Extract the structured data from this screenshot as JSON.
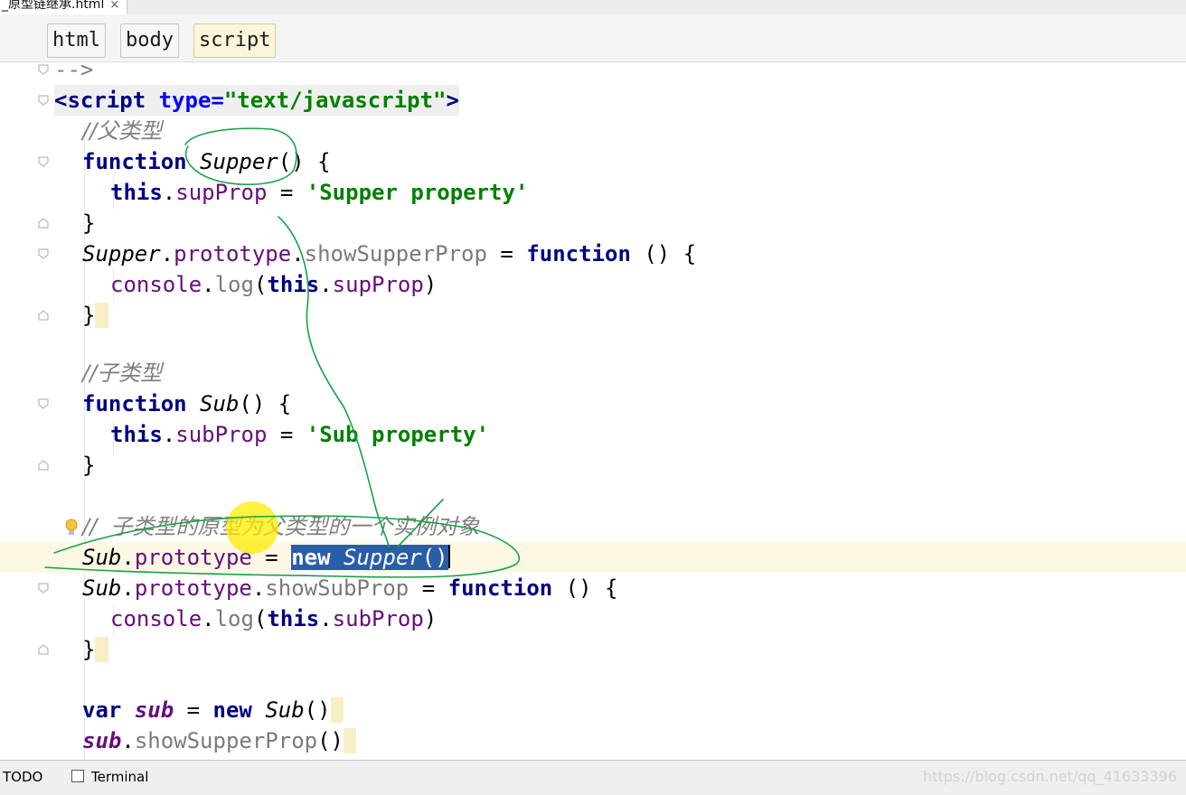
{
  "tab": {
    "title": "_原型链继承.html",
    "close": "×"
  },
  "breadcrumb": [
    "html",
    "body",
    "script"
  ],
  "code": {
    "l0": "-->",
    "l1_tag_open": "<script ",
    "l1_attr": "type=",
    "l1_val": "\"text/javascript\"",
    "l1_close": ">",
    "l2": "//父类型",
    "l3_kw": "function",
    "l3_name": "Supper",
    "l3_rest": "() {",
    "l4_this": "this",
    "l4_dot": ".",
    "l4_prop": "supProp",
    "l4_eq": " = ",
    "l4_str": "'Supper property'",
    "l5": "}",
    "l6_obj": "Supper",
    "l6_dot": ".",
    "l6_proto": "prototype",
    "l6_dot2": ".",
    "l6_method": "showSupperProp",
    "l6_eq": " = ",
    "l6_kw": "function",
    "l6_rest": " () {",
    "l7_console": "console",
    "l7_dot": ".",
    "l7_log": "log",
    "l7_open": "(",
    "l7_this": "this",
    "l7_dot2": ".",
    "l7_prop": "supProp",
    "l7_close": ")",
    "l8": "}",
    "l10": "//子类型",
    "l11_kw": "function",
    "l11_name": "Sub",
    "l11_rest": "() {",
    "l12_this": "this",
    "l12_dot": ".",
    "l12_prop": "subProp",
    "l12_eq": " = ",
    "l12_str": "'Sub property'",
    "l13": "}",
    "l15": "//  子类型的原型为父类型的一个实例对象",
    "l16_obj": "Sub",
    "l16_dot": ".",
    "l16_proto": "prototype",
    "l16_eq": " = ",
    "l16_new": "new ",
    "l16_cls": "Supper",
    "l16_paren": "()",
    "l17_obj": "Sub",
    "l17_dot": ".",
    "l17_proto": "prototype",
    "l17_dot2": ".",
    "l17_method": "showSubProp",
    "l17_eq": " = ",
    "l17_kw": "function",
    "l17_rest": " () {",
    "l18_console": "console",
    "l18_dot": ".",
    "l18_log": "log",
    "l18_open": "(",
    "l18_this": "this",
    "l18_dot2": ".",
    "l18_prop": "subProp",
    "l18_close": ")",
    "l19": "}",
    "l21_kw": "var",
    "l21_var": " sub",
    "l21_eq": " = ",
    "l21_new": "new ",
    "l21_cls": "Sub",
    "l21_paren": "()",
    "l22_var": "sub",
    "l22_dot": ".",
    "l22_method": "showSupperProp",
    "l22_paren": "()"
  },
  "statusbar": {
    "todo": "TODO",
    "terminal": "Terminal",
    "watermark": "https://blog.csdn.net/qq_41633396"
  },
  "colors": {
    "keyword": "#000080",
    "property": "#660e7a",
    "string": "#008000",
    "comment": "#808080",
    "selection": "#2a5da8",
    "annotation": "#16a34a",
    "highlighter": "#ffec00"
  }
}
